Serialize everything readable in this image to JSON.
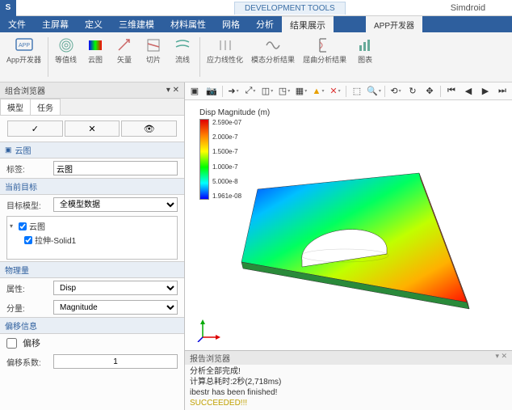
{
  "app": {
    "title": "Simdroid",
    "dev_tools": "DEVELOPMENT TOOLS",
    "sub_tab": "APP开发器"
  },
  "menu": [
    "文件",
    "主屏幕",
    "定义",
    "三维建模",
    "材料属性",
    "网格",
    "分析",
    "结果展示"
  ],
  "menu_active_index": 7,
  "ribbon": [
    {
      "label": "App开发器",
      "icon": "app"
    },
    {
      "label": "等值线",
      "icon": "contour"
    },
    {
      "label": "云图",
      "icon": "cloud"
    },
    {
      "label": "矢量",
      "icon": "vector"
    },
    {
      "label": "切片",
      "icon": "slice"
    },
    {
      "label": "流线",
      "icon": "stream"
    },
    {
      "label": "应力线性化",
      "icon": "stress"
    },
    {
      "label": "模态分析结果",
      "icon": "modal"
    },
    {
      "label": "屈曲分析结果",
      "icon": "buckling"
    },
    {
      "label": "图表",
      "icon": "chart"
    }
  ],
  "side": {
    "browser_title": "组合浏览器",
    "tabs": [
      "模型",
      "任务"
    ],
    "cloud_section": "云图",
    "label_label": "标签:",
    "label_value": "云图",
    "target_section": "当前目标",
    "target_model_label": "目标模型:",
    "target_model_value": "全模型数据",
    "tree": {
      "root": "云图",
      "child": "拉伸-Solid1"
    },
    "phys_section": "物理量",
    "prop_label": "属性:",
    "prop_value": "Disp",
    "comp_label": "分量:",
    "comp_value": "Magnitude",
    "offset_section": "偏移信息",
    "offset_chk_label": "偏移",
    "offset_factor_label": "偏移系数:",
    "offset_factor_value": "1"
  },
  "legend": {
    "title": "Disp Magnitude (m)",
    "ticks": [
      "2.590e-07",
      "2.000e-7",
      "1.500e-7",
      "1.000e-7",
      "5.000e-8",
      "1.961e-08"
    ]
  },
  "report": {
    "title": "报告浏览器",
    "lines": [
      "分析全部完成!",
      "计算总耗时:2秒(2,718ms)",
      "ibestr has been finished!"
    ],
    "success": "SUCCEEDED!!!"
  },
  "chart_data": {
    "type": "contour-3d",
    "title": "Disp Magnitude (m)",
    "colormap": "rainbow",
    "range": [
      1.961e-08,
      2.59e-07
    ],
    "ticks": [
      1.961e-08,
      5e-08,
      1e-07,
      1.5e-07,
      2e-07,
      2.59e-07
    ],
    "geometry": "triangular plate with semicircular cutout",
    "description": "Displacement magnitude distribution; low (blue) at upper-left vertex increasing to high (red) at lower-right vertex"
  }
}
